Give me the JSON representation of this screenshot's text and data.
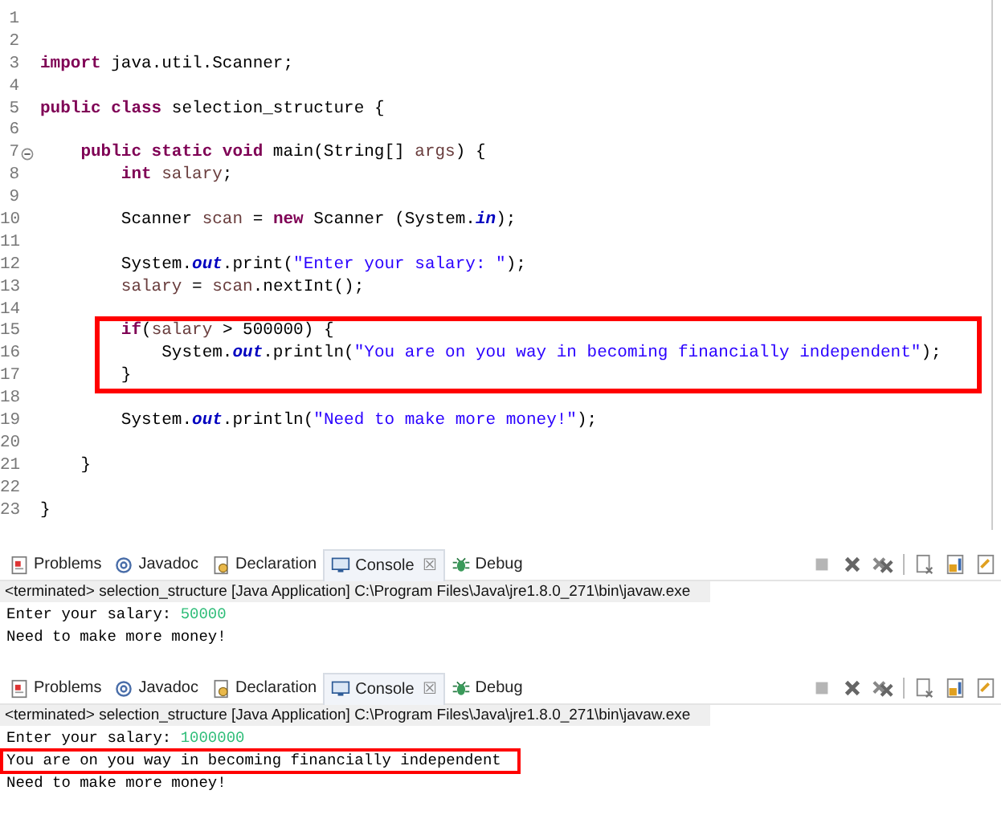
{
  "editor": {
    "blocks": [
      {
        "highlighted": false,
        "lines": [
          {
            "number": "1"
          },
          {
            "number": "2"
          },
          {
            "number": "3",
            "tokens": [
              {
                "kind": "kw",
                "text": "import"
              },
              {
                "kind": "plain",
                "text": " java.util.Scanner;"
              }
            ]
          },
          {
            "number": "4"
          },
          {
            "number": "5",
            "tokens": [
              {
                "kind": "kw",
                "text": "public class"
              },
              {
                "kind": "plain",
                "text": " selection_structure {"
              }
            ]
          },
          {
            "number": "6"
          },
          {
            "number": "7",
            "fold": true,
            "kind": "method",
            "tokens": [
              {
                "kind": "kw",
                "text": "public static void"
              },
              {
                "kind": "plain",
                "text": " main(String[] "
              },
              {
                "kind": "var",
                "text": "args"
              },
              {
                "kind": "plain",
                "text": ") {"
              }
            ]
          },
          {
            "number": "8",
            "kind": "statement",
            "tokens": [
              {
                "kind": "kw",
                "text": "int"
              },
              {
                "kind": "var",
                "text": " salary"
              },
              {
                "kind": "plain",
                "text": ";"
              }
            ]
          },
          {
            "number": "9"
          },
          {
            "number": "10",
            "kind": "statement",
            "tokens": [
              {
                "kind": "plain",
                "text": "Scanner "
              },
              {
                "kind": "var",
                "text": "scan"
              },
              {
                "kind": "plain",
                "text": " = "
              },
              {
                "kind": "kw",
                "text": "new"
              },
              {
                "kind": "plain",
                "text": " Scanner (System."
              },
              {
                "kind": "field",
                "text": "in"
              },
              {
                "kind": "plain",
                "text": ");"
              }
            ]
          },
          {
            "number": "11"
          },
          {
            "number": "12",
            "kind": "statement",
            "tokens": [
              {
                "kind": "plain",
                "text": "System."
              },
              {
                "kind": "field",
                "text": "out"
              },
              {
                "kind": "plain",
                "text": ".print("
              },
              {
                "kind": "str",
                "text": "\"Enter your salary: \""
              },
              {
                "kind": "plain",
                "text": ");"
              }
            ]
          },
          {
            "number": "13",
            "kind": "statement",
            "tokens": [
              {
                "kind": "var",
                "text": "salary"
              },
              {
                "kind": "plain",
                "text": " = "
              },
              {
                "kind": "var",
                "text": "scan"
              },
              {
                "kind": "plain",
                "text": ".nextInt();"
              }
            ]
          },
          {
            "number": "14"
          }
        ]
      },
      {
        "highlighted": true,
        "lines": [
          {
            "number": "15",
            "kind": "statement",
            "tokens": [
              {
                "kind": "kw",
                "text": "if"
              },
              {
                "kind": "plain",
                "text": "("
              },
              {
                "kind": "var",
                "text": "salary"
              },
              {
                "kind": "plain",
                "text": " > 500000) {"
              }
            ]
          },
          {
            "number": "16",
            "kind": "nested",
            "tokens": [
              {
                "kind": "plain",
                "text": "System."
              },
              {
                "kind": "field",
                "text": "out"
              },
              {
                "kind": "plain",
                "text": ".println("
              },
              {
                "kind": "str",
                "text": "\"You are on you way in becoming financially independent\""
              },
              {
                "kind": "plain",
                "text": ");"
              }
            ]
          },
          {
            "number": "17",
            "kind": "statement",
            "tokens": [
              {
                "kind": "plain",
                "text": "}"
              }
            ]
          }
        ]
      },
      {
        "highlighted": false,
        "lines": [
          {
            "number": "18"
          },
          {
            "number": "19",
            "kind": "statement",
            "tokens": [
              {
                "kind": "plain",
                "text": "System."
              },
              {
                "kind": "field",
                "text": "out"
              },
              {
                "kind": "plain",
                "text": ".println("
              },
              {
                "kind": "str",
                "text": "\"Need to make more money!\""
              },
              {
                "kind": "plain",
                "text": ");"
              }
            ]
          },
          {
            "number": "20"
          },
          {
            "number": "21",
            "kind": "method",
            "tokens": [
              {
                "kind": "plain",
                "text": "}"
              }
            ]
          },
          {
            "number": "22"
          },
          {
            "number": "23",
            "tokens": [
              {
                "kind": "plain",
                "text": "}"
              }
            ]
          }
        ]
      }
    ]
  },
  "consoles": [
    {
      "tabs": [
        {
          "label": "Problems",
          "selected": false
        },
        {
          "label": "Javadoc",
          "selected": false
        },
        {
          "label": "Declaration",
          "selected": false
        },
        {
          "label": "Console",
          "selected": true,
          "close": "☒"
        },
        {
          "label": "Debug",
          "selected": false
        }
      ],
      "header": "<terminated> selection_structure [Java Application] C:\\Program Files\\Java\\jre1.8.0_271\\bin\\javaw.exe",
      "output": [
        {
          "highlighted": false,
          "segments": [
            {
              "kind": "out",
              "text": "Enter your salary: "
            },
            {
              "kind": "input",
              "text": "50000"
            }
          ]
        },
        {
          "highlighted": false,
          "segments": [
            {
              "kind": "out",
              "text": "Need to make more money!"
            }
          ]
        }
      ]
    },
    {
      "tabs": [
        {
          "label": "Problems",
          "selected": false
        },
        {
          "label": "Javadoc",
          "selected": false
        },
        {
          "label": "Declaration",
          "selected": false
        },
        {
          "label": "Console",
          "selected": true,
          "close": "☒"
        },
        {
          "label": "Debug",
          "selected": false
        }
      ],
      "header": "<terminated> selection_structure [Java Application] C:\\Program Files\\Java\\jre1.8.0_271\\bin\\javaw.exe",
      "output": [
        {
          "highlighted": false,
          "segments": [
            {
              "kind": "out",
              "text": "Enter your salary: "
            },
            {
              "kind": "input",
              "text": "1000000"
            }
          ]
        },
        {
          "highlighted": true,
          "segments": [
            {
              "kind": "out",
              "text": "You are on you way in becoming financially independent"
            }
          ]
        },
        {
          "highlighted": false,
          "segments": [
            {
              "kind": "out",
              "text": "Need to make more money!"
            }
          ]
        }
      ]
    }
  ]
}
